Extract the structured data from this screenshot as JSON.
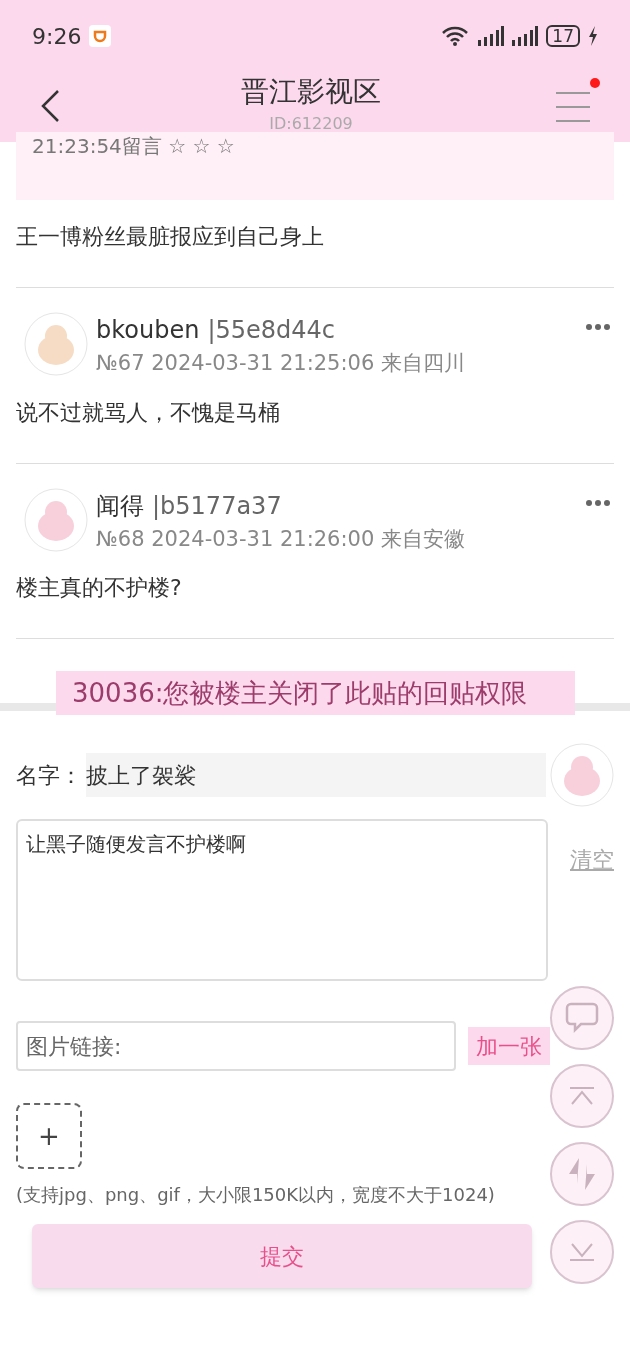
{
  "status_bar": {
    "time": "9:26",
    "battery": "17"
  },
  "header": {
    "title": "晋江影视区",
    "subtitle": "ID:612209",
    "has_notification": true
  },
  "quoted_reply": {
    "text": "21:23:54留言 ☆ ☆ ☆"
  },
  "first_body": "王一博粉丝最脏报应到自己身上",
  "posts": [
    {
      "name": "bkouben",
      "hash": "|55e8d44c",
      "meta": "№67 2024-03-31 21:25:06 来自四川",
      "body": "说不过就骂人，不愧是马桶"
    },
    {
      "name": "闻得",
      "hash": "|b5177a37",
      "meta": "№68 2024-03-31 21:26:00 来自安徽",
      "body": "楼主真的不护楼?"
    }
  ],
  "toast": "30036:您被楼主关闭了此贴的回贴权限",
  "form": {
    "name_label": "名字：",
    "name_value": "披上了袈裟",
    "message": "让黑子随便发言不护楼啊",
    "clear": "清空",
    "image_placeholder": "图片链接:",
    "add_button": "加一张",
    "upload": "+",
    "hint": "(支持jpg、png、gif，大小限150K以内，宽度不大于1024)",
    "submit": "提交"
  }
}
